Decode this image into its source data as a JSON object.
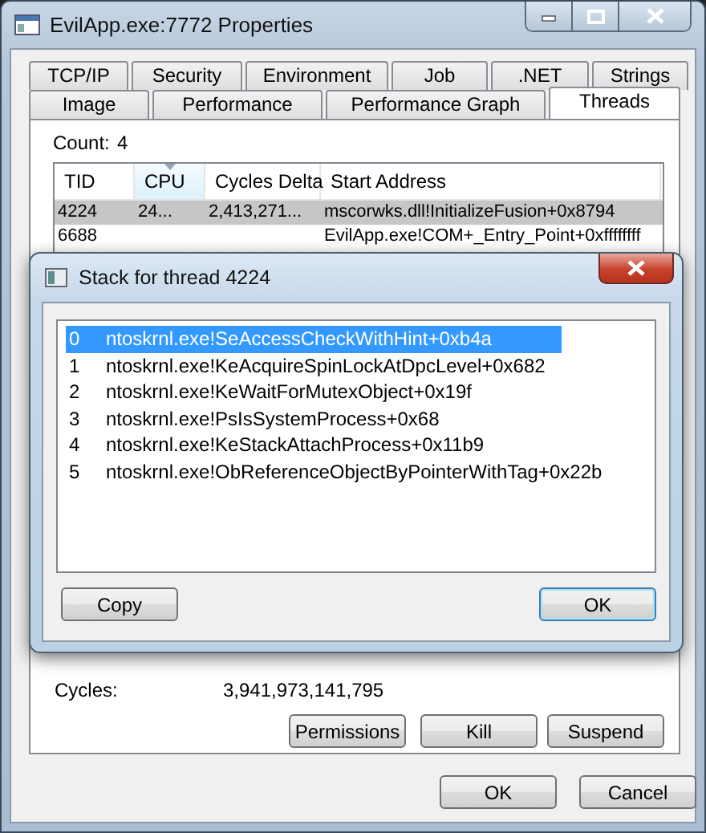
{
  "window": {
    "title": "EvilApp.exe:7772 Properties"
  },
  "tab_rows": [
    [
      {
        "label": "TCP/IP",
        "selected": false
      },
      {
        "label": "Security",
        "selected": false
      },
      {
        "label": "Environment",
        "selected": false
      },
      {
        "label": "Job",
        "selected": false
      },
      {
        "label": ".NET",
        "selected": false
      },
      {
        "label": "Strings",
        "selected": false
      }
    ],
    [
      {
        "label": "Image",
        "selected": false
      },
      {
        "label": "Performance",
        "selected": false
      },
      {
        "label": "Performance Graph",
        "selected": false
      },
      {
        "label": "Threads",
        "selected": true
      }
    ]
  ],
  "count": {
    "label": "Count:",
    "value": "4"
  },
  "threads": {
    "columns": [
      {
        "label": "TID",
        "sorted": false
      },
      {
        "label": "CPU",
        "sorted": true
      },
      {
        "label": "Cycles Delta",
        "sorted": false
      },
      {
        "label": "Start Address",
        "sorted": false
      }
    ],
    "rows": [
      {
        "tid": "4224",
        "cpu": "24...",
        "cycles_delta": "2,413,271...",
        "start_address": "mscorwks.dll!InitializeFusion+0x8794",
        "selected": true
      },
      {
        "tid": "6688",
        "start_address": "EvilApp.exe!COM+_Entry_Point+0xffffffff",
        "selected": false
      }
    ]
  },
  "cycles": {
    "label": "Cycles:",
    "value": "3,941,973,141,795"
  },
  "thread_buttons": [
    "Permissions",
    "Kill",
    "Suspend"
  ],
  "dialog_buttons": [
    "OK",
    "Cancel"
  ],
  "stack_dialog": {
    "title": "Stack for thread 4224",
    "frames": [
      {
        "index": "0",
        "text": "ntoskrnl.exe!SeAccessCheckWithHint+0xb4a",
        "selected": true
      },
      {
        "index": "1",
        "text": "ntoskrnl.exe!KeAcquireSpinLockAtDpcLevel+0x682",
        "selected": false
      },
      {
        "index": "2",
        "text": "ntoskrnl.exe!KeWaitForMutexObject+0x19f",
        "selected": false
      },
      {
        "index": "3",
        "text": "ntoskrnl.exe!PsIsSystemProcess+0x68",
        "selected": false
      },
      {
        "index": "4",
        "text": "ntoskrnl.exe!KeStackAttachProcess+0x11b9",
        "selected": false
      },
      {
        "index": "5",
        "text": "ntoskrnl.exe!ObReferenceObjectByPointerWithTag+0x22b",
        "selected": false
      }
    ],
    "buttons": [
      {
        "label": "Copy",
        "default": false
      },
      {
        "label": "OK",
        "default": true
      }
    ]
  }
}
